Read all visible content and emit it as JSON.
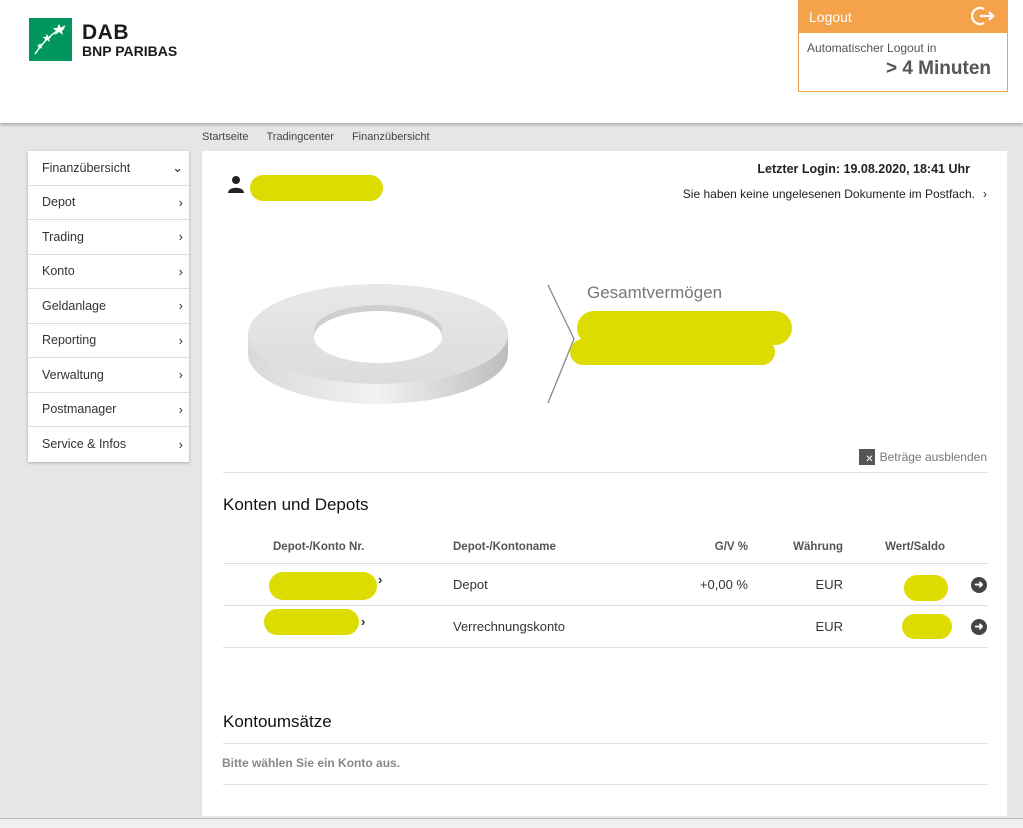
{
  "brand": {
    "line1": "DAB",
    "line2": "BNP PARIBAS",
    "color": "#00965e"
  },
  "logout": {
    "button_label": "Logout",
    "auto_label": "Automatischer Logout in",
    "time": "> 4 Minuten",
    "accent": "#f5a34a",
    "icon": "logout-icon"
  },
  "breadcrumb": [
    "Startseite",
    "Tradingcenter",
    "Finanzübersicht"
  ],
  "sidebar": {
    "items": [
      {
        "label": "Finanzübersicht",
        "chevron": "⌄"
      },
      {
        "label": "Depot",
        "chevron": "›"
      },
      {
        "label": "Trading",
        "chevron": "›"
      },
      {
        "label": "Konto",
        "chevron": "›"
      },
      {
        "label": "Geldanlage",
        "chevron": "›"
      },
      {
        "label": "Reporting",
        "chevron": "›"
      },
      {
        "label": "Verwaltung",
        "chevron": "›"
      },
      {
        "label": "Postmanager",
        "chevron": "›"
      },
      {
        "label": "Service & Infos",
        "chevron": "›"
      }
    ]
  },
  "main": {
    "last_login": "Letzter Login: 19.08.2020, 18:41 Uhr",
    "postfach": "Sie haben keine ungelesenen Dokumente im Postfach.",
    "gesamt_label": "Gesamtvermögen",
    "hide_amounts": "Beträge ausblenden",
    "accounts_title": "Konten und Depots",
    "columns": [
      "Depot-/Konto Nr.",
      "Depot-/Kontoname",
      "G/V %",
      "Währung",
      "Wert/Saldo"
    ],
    "rows": [
      {
        "name": "Depot",
        "gv": "+0,00 %",
        "currency": "EUR"
      },
      {
        "name": "Verrechnungskonto",
        "gv": "",
        "currency": "EUR"
      }
    ],
    "transactions_title": "Kontoumsätze",
    "no_account_text": "Bitte wählen Sie ein Konto aus."
  },
  "colors": {
    "redaction": "#dcdc00",
    "positive": "#2a9d2a"
  }
}
